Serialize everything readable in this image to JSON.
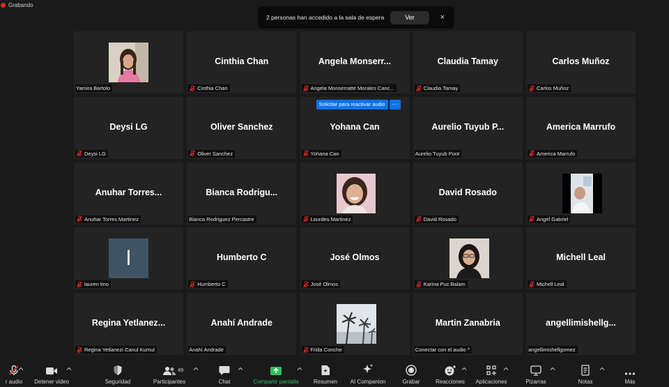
{
  "recording": {
    "label": "Grabando"
  },
  "notification": {
    "text": "2 personas han accedido a la sala de espera",
    "view_label": "Ver",
    "close_glyph": "×"
  },
  "colors": {
    "tile_bg": "#232323",
    "accent_blue": "#0e72ed",
    "muted_red": "#e02828",
    "share_green": "#2fbe5c"
  },
  "tiles": [
    {
      "display": "",
      "label": "Yamira Bartolo",
      "muted": false,
      "photo": "girl-portrait"
    },
    {
      "display": "Cinthia Chan",
      "label": "Cinthia Chan",
      "muted": true
    },
    {
      "display": "Angela  Monserr...",
      "label": "Angela Monserratte Morales Canc...",
      "muted": true
    },
    {
      "display": "Claudia Tamay",
      "label": "Claudia Tamay",
      "muted": true
    },
    {
      "display": "Carlos Muñoz",
      "label": "Carlos Muñoz",
      "muted": true
    },
    {
      "display": "Deysi LG",
      "label": "Deysi LG",
      "muted": true
    },
    {
      "display": "Oliver Sanchez",
      "label": "Oliver Sanchez",
      "muted": true
    },
    {
      "display": "Yohana Can",
      "label": "Yohana Can",
      "muted": true,
      "unmute_request": "Solicitar para reactivar audio",
      "more_glyph": "···"
    },
    {
      "display": "Aurelio Tuyub P...",
      "label": "Aurelio Tuyub Poot",
      "muted": false
    },
    {
      "display": "America Marrufo",
      "label": "America Marrufo",
      "muted": true
    },
    {
      "display": "Anuhar  Torres...",
      "label": "Anuhar Torres Martinez",
      "muted": true
    },
    {
      "display": "Bianca  Rodrigu...",
      "label": "Bianca Rodriguez Percastre",
      "muted": false
    },
    {
      "display": "",
      "label": "Lourdes Martinez",
      "muted": true,
      "photo": "smiling-portrait"
    },
    {
      "display": "David Rosado",
      "label": "David Rosado",
      "muted": true
    },
    {
      "display": "",
      "label": "Angel Gabriel",
      "muted": true,
      "photo": "webcam-person"
    },
    {
      "display": "",
      "label": "lauren tino",
      "muted": true,
      "photo": "initial-avatar",
      "initial": "l"
    },
    {
      "display": "Humberto C",
      "label": "Humberto C",
      "muted": true
    },
    {
      "display": "José Olmos",
      "label": "José Olmos",
      "muted": true
    },
    {
      "display": "",
      "label": "Karina Puc Balam",
      "muted": true,
      "photo": "woman-glasses"
    },
    {
      "display": "Michell Leal",
      "label": "Michell Leal",
      "muted": true
    },
    {
      "display": "Regina  Yetlanez...",
      "label": "Regina Yetlanezi Canul Kumul",
      "muted": true
    },
    {
      "display": "Anahí Andrade",
      "label": "Anahí Andrade",
      "muted": false
    },
    {
      "display": "",
      "label": "Frida Conche",
      "muted": true,
      "photo": "palm-trees"
    },
    {
      "display": "Martin Zanabria",
      "label": "Conectar con el audio ^",
      "muted": false
    },
    {
      "display": "angellimishellg...",
      "label": "angellimishellgomez",
      "muted": false
    }
  ],
  "toolbar": {
    "audio": "r audio",
    "video": "Detener video",
    "security": "Seguridad",
    "participants": "Participantes",
    "participants_count": "49",
    "chat": "Chat",
    "share": "Compartir pantalla",
    "summary": "Resumen",
    "ai_companion": "AI Companion",
    "record": "Grabar",
    "reactions": "Reacciones",
    "apps": "Aplicaciones",
    "whiteboards": "Pizarras",
    "notes": "Notas",
    "more": "Más"
  }
}
